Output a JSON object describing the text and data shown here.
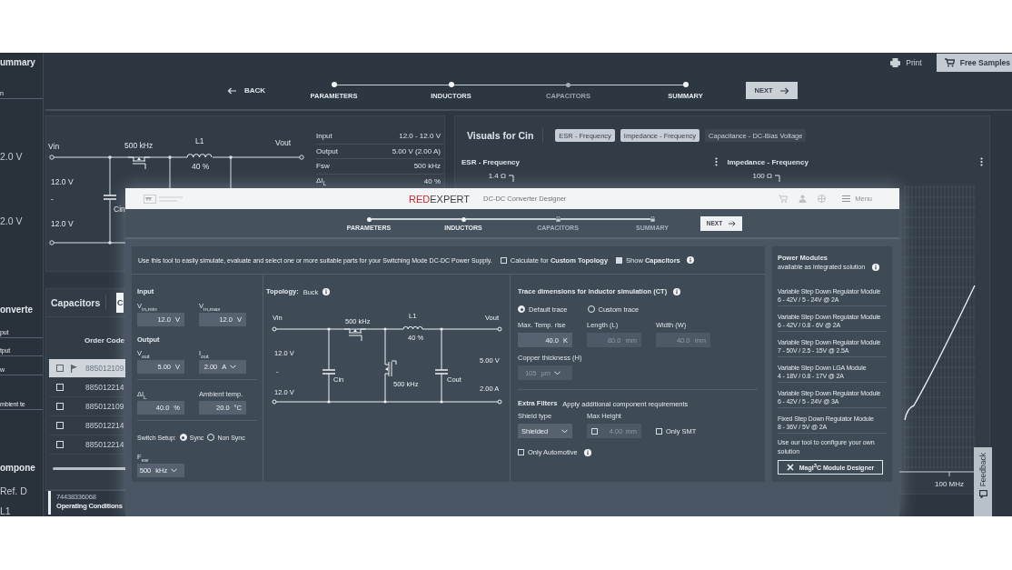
{
  "screen": {
    "sidebar": [
      {
        "kind": "heading",
        "text": "ummary"
      },
      {
        "kind": "item",
        "text": "n"
      },
      {
        "kind": "value",
        "text": "2.0 V"
      },
      {
        "kind": "value",
        "text": "2.0 V"
      },
      {
        "kind": "heading",
        "text": "onverte"
      },
      {
        "kind": "item",
        "text": "put"
      },
      {
        "kind": "item",
        "text": "tput"
      },
      {
        "kind": "item",
        "text": "w"
      },
      {
        "kind": "item",
        "text": "mbient te"
      },
      {
        "kind": "heading",
        "text": "ompone"
      },
      {
        "kind": "column",
        "text": "Ref. D"
      },
      {
        "kind": "value",
        "text": "L1"
      }
    ],
    "print": "Print",
    "free_samples": "Free Samples",
    "back": "BACK",
    "steps": [
      {
        "label": "PARAMETERS",
        "reached": true
      },
      {
        "label": "INDUCTORS",
        "reached": true
      },
      {
        "label": "CAPACITORS",
        "reached": false
      },
      {
        "label": "SUMMARY",
        "reached": true
      }
    ],
    "next": "NEXT",
    "schematic": {
      "vin": "Vin",
      "freq": "500 kHz",
      "inductor": "L1",
      "ripple": "40 %",
      "vout": "Vout",
      "vin_max": "12.0 V",
      "separator": "-",
      "vin_min": "12.0 V",
      "cin": "Cin"
    },
    "parameters": [
      {
        "label": "Input",
        "value": "12.0 - 12.0 V"
      },
      {
        "label": "Output",
        "value": "5.00 V (2.00 A)"
      },
      {
        "label": "Fsw",
        "value": "500 kHz"
      },
      {
        "label": "ΔI$_{L}$",
        "value": "40 %"
      }
    ],
    "visuals": {
      "title": "Visuals for Cin",
      "tabs": [
        {
          "label": "ESR - Frequency",
          "selected": true
        },
        {
          "label": "Impedance - Frequency",
          "selected": true
        },
        {
          "label": "Capacitance - DC-Bias Voltage",
          "selected": false
        }
      ],
      "charts": [
        {
          "title": "ESR - Frequency",
          "y_tick": "1.4 Ω"
        },
        {
          "title": "Impedance - Frequency",
          "y_tick": "100 Ω",
          "x_tick": "100 MHz"
        }
      ]
    },
    "capacitors": {
      "title": "Capacitors",
      "filter": "C",
      "column": "Order Code",
      "rows": [
        {
          "code": "885012109",
          "checked": false,
          "flagged": true,
          "selected": true
        },
        {
          "code": "885012214",
          "checked": false,
          "flagged": false,
          "selected": false
        },
        {
          "code": "885012109",
          "checked": false,
          "flagged": false,
          "selected": false
        },
        {
          "code": "885012214",
          "checked": false,
          "flagged": false,
          "selected": false
        },
        {
          "code": "885012214",
          "checked": false,
          "flagged": false,
          "selected": false
        }
      ]
    },
    "bottom": {
      "order_code": "74438336068",
      "section": "Operating Conditions"
    },
    "feedback": "Feedback"
  },
  "designer": {
    "brand_red": "RED",
    "brand": "EXPERT",
    "title": "DC-DC Converter Designer",
    "menu": "Menu",
    "steps": [
      {
        "label": "PARAMETERS",
        "locked": false
      },
      {
        "label": "INDUCTORS",
        "locked": false
      },
      {
        "label": "CAPACITORS",
        "locked": true
      },
      {
        "label": "SUMMARY",
        "locked": true
      }
    ],
    "next": "NEXT",
    "intro": "Use this tool to easily simulate, evaluate and select one or more suitable parts for your Switching Mode DC-DC Power Supply.",
    "options": [
      {
        "label": "Calculate for **Custom Topology**",
        "checked": false,
        "info": false
      },
      {
        "label": "Show **Capacitors**",
        "checked": true,
        "info": true
      }
    ],
    "input": {
      "heading": "Input",
      "fields": [
        {
          "label": "V$_{in,min}$",
          "value": "12.0",
          "unit": "V",
          "kind": "number"
        },
        {
          "label": "V$_{in,max}$",
          "value": "12.0",
          "unit": "V",
          "kind": "number"
        }
      ]
    },
    "output": {
      "heading": "Output",
      "fields": [
        {
          "label": "V$_{out}$",
          "value": "5.00",
          "unit": "V",
          "kind": "number"
        },
        {
          "label": "I$_{out}$",
          "value": "2.00",
          "unit": "A",
          "kind": "select"
        }
      ]
    },
    "ripple_fields": [
      {
        "label": "ΔI$_{L}$",
        "value": "40.0",
        "unit": "%",
        "kind": "number"
      },
      {
        "label": "Ambient temp.",
        "value": "20.0",
        "unit": "°C",
        "kind": "number"
      }
    ],
    "switch_setup": {
      "label": "Switch Setup:",
      "options": [
        {
          "label": "Sync",
          "selected": true
        },
        {
          "label": "Non Sync",
          "selected": false
        }
      ]
    },
    "fsw": {
      "label": "F$_{sw}$",
      "value": "500",
      "unit": "kHz",
      "kind": "select"
    },
    "topology": {
      "label": "Topology:",
      "value": "Buck"
    },
    "schematic": {
      "vin": "Vin",
      "vout": "Vout",
      "freq_high": "500 kHz",
      "inductor": "L1",
      "ripple": "40 %",
      "vin_max": "12.0 V",
      "separator": "-",
      "vin_min": "12.0 V",
      "cin": "Cin",
      "freq_low": "500 kHz",
      "cout": "Cout",
      "vout_value": "5.00 V",
      "iout_value": "2.00 A"
    },
    "trace": {
      "title": "Trace dimensions for inductor simulation (CT)",
      "options": [
        {
          "label": "Default trace",
          "selected": true
        },
        {
          "label": "Custom trace",
          "selected": false
        }
      ],
      "fields": [
        {
          "label": "Max. Temp. rise",
          "value": "40.0",
          "unit": "K",
          "kind": "number",
          "disabled": false
        },
        {
          "label": "Length (L)",
          "value": "80.0",
          "unit": "mm",
          "kind": "number",
          "disabled": true
        },
        {
          "label": "Width (W)",
          "value": "40.0",
          "unit": "mm",
          "kind": "number",
          "disabled": true
        }
      ],
      "copper": {
        "label": "Copper thickness (H)",
        "value": "105",
        "unit": "µm",
        "kind": "select",
        "disabled": true
      }
    },
    "extra_filters": {
      "title": "Extra Filters",
      "hint": "Apply additional component requirements",
      "shield_label": "Shield type",
      "shield_value": "Shielded",
      "max_height_label": "Max Height",
      "max_height_checked": false,
      "max_height_value": "4.00",
      "max_height_unit": "mm",
      "only_smt": {
        "label": "Only SMT",
        "checked": false
      },
      "only_automotive": {
        "label": "Only Automotive",
        "checked": false
      }
    },
    "power_modules": {
      "title": "Power Modules",
      "subtitle": "available as integrated solution",
      "items": [
        {
          "name": "Variable Step Down Regulator Module",
          "spec": "6 - 42V / 5 - 24V @ 2A"
        },
        {
          "name": "Variable Step Down Regulator Module",
          "spec": "6 - 42V / 0.8 - 6V @ 2A"
        },
        {
          "name": "Variable Step Down Regulator Module",
          "spec": "7 - 50V / 2.5 - 15V @ 2.5A"
        },
        {
          "name": "Variable Step Down LGA Module",
          "spec": "4 - 18V / 0.8 - 17V @ 2A"
        },
        {
          "name": "Variable Step Down Regulator Module",
          "spec": "6 - 42V / 5 - 24V @ 3A"
        },
        {
          "name": "Fixed Step Down Regulator Module",
          "spec": "8 - 36V / 5V @ 2A"
        }
      ],
      "footer": "Use our tool to configure your own solution",
      "button": "MagI$^{3}$C Module Designer"
    }
  }
}
